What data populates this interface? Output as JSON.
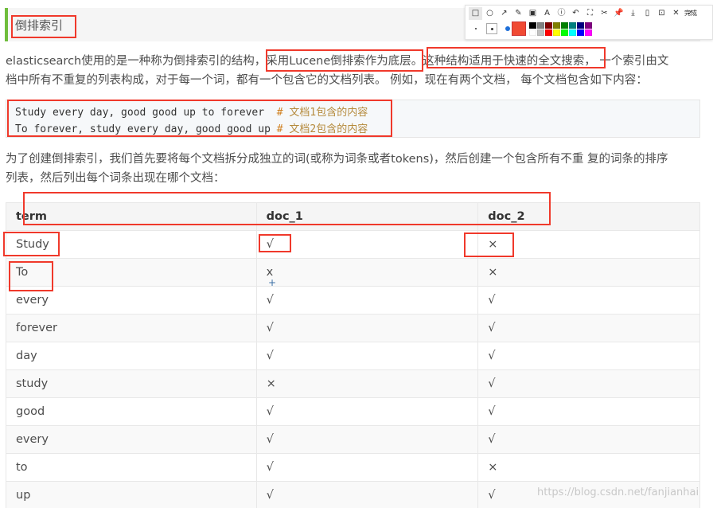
{
  "heading": "倒排索引",
  "toolbar": {
    "tools": [
      "□",
      "○",
      "↗",
      "✎",
      "▣",
      "A",
      "ⓘ",
      "↶",
      "⛶",
      "✂",
      "📌",
      "⤓",
      "▯",
      "⊡",
      "✕",
      "✓"
    ],
    "done": "完成",
    "current_color": "#f04a33",
    "palette": [
      "#000000",
      "#808080",
      "#800000",
      "#808000",
      "#008000",
      "#008080",
      "#000080",
      "#800080",
      "#ffffff",
      "#c0c0c0",
      "#ff0000",
      "#ffff00",
      "#00ff00",
      "#00ffff",
      "#0000ff",
      "#ff00ff"
    ]
  },
  "intro": {
    "line1_a": "elasticsearch使用的是一种称为倒排索引的结构，",
    "line1_b": "采用Lucene倒排索作为底层。",
    "line1_c": "这种结构适用于快速的全文搜索",
    "line1_d": "， 一个索引由文",
    "line2": "档中所有不重复的列表构成，对于每一个词，都有一个包含它的文档列表。 例如，现在有两个文档， 每个文档包含如下内容："
  },
  "code": {
    "line1_text": "Study every day, good good up to forever  ",
    "line1_hash": "# ",
    "line1_comment": "文档1包含的内容",
    "line2_text": "To forever, study every day, good good up ",
    "line2_hash": "# ",
    "line2_comment": "文档2包含的内容"
  },
  "desc": {
    "line1": "为了创建倒排索引，我们首先要将每个文档拆分成独立的词(或称为词条或者tokens)，然后创建一个包含所有不重 复的词条的排序",
    "line2": "列表，然后列出每个词条出现在哪个文档："
  },
  "table": {
    "headers": [
      "term",
      "doc_1",
      "doc_2"
    ],
    "rows": [
      [
        "Study",
        "√",
        "×"
      ],
      [
        "To",
        "x",
        "×"
      ],
      [
        "every",
        "√",
        "√"
      ],
      [
        "forever",
        "√",
        "√"
      ],
      [
        "day",
        "√",
        "√"
      ],
      [
        "study",
        "×",
        "√"
      ],
      [
        "good",
        "√",
        "√"
      ],
      [
        "every",
        "√",
        "√"
      ],
      [
        "to",
        "√",
        "×"
      ],
      [
        "up",
        "√",
        "√"
      ]
    ]
  },
  "watermark": "https://blog.csdn.net/fanjianhai"
}
